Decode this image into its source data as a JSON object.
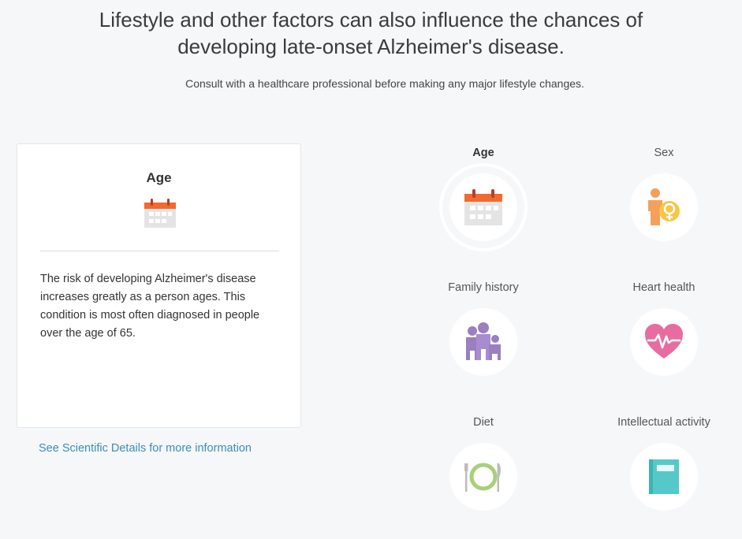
{
  "header": {
    "title_line1": "Lifestyle and other factors can also influence the chances of",
    "title_line2": "developing late-onset Alzheimer's disease.",
    "subtitle": "Consult with a healthcare professional before making any major lifestyle changes."
  },
  "detail": {
    "title": "Age",
    "icon": "calendar-icon",
    "text": "The risk of developing Alzheimer's disease increases greatly as a person ages. This condition is most often diagnosed in people over the age of 65.",
    "link": "See Scientific Details for more information"
  },
  "factors": [
    {
      "label": "Age",
      "icon": "calendar-icon",
      "selected": true
    },
    {
      "label": "Sex",
      "icon": "female-person-icon",
      "selected": false
    },
    {
      "label": "Family history",
      "icon": "family-icon",
      "selected": false
    },
    {
      "label": "Heart health",
      "icon": "heart-icon",
      "selected": false
    },
    {
      "label": "Diet",
      "icon": "plate-icon",
      "selected": false
    },
    {
      "label": "Intellectual activity",
      "icon": "book-icon",
      "selected": false
    }
  ],
  "colors": {
    "link": "#3a8fb7",
    "calendar_accent": "#f26a2e",
    "sex": "#f5a05a",
    "family": "#9b7fc0",
    "heart": "#e76da0",
    "diet": "#a6d07a",
    "book": "#55c9c9"
  }
}
